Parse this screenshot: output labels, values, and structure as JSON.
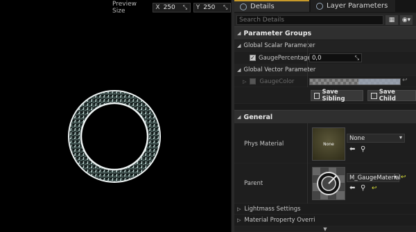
{
  "viewport": {
    "preview_size_label": "Preview Size",
    "x_axis": "X",
    "x_value": "250",
    "y_axis": "Y",
    "y_value": "250"
  },
  "tabs": [
    {
      "label": "Details",
      "icon": "details-icon",
      "active": true
    },
    {
      "label": "Layer Parameters",
      "icon": "layer-parameters-icon",
      "active": false
    }
  ],
  "search": {
    "placeholder": "Search Details"
  },
  "parameter_groups": {
    "header": "Parameter Groups",
    "scalar_group": "Global Scalar Parameter",
    "scalar_param": {
      "label": "GaugePercentage",
      "value": "0,0",
      "enabled": true
    },
    "vector_group": "Global Vector Parameter",
    "vector_param": {
      "label": "GaugeColor",
      "enabled": false
    },
    "save_sibling": "Save Sibling",
    "save_child": "Save Child"
  },
  "general": {
    "header": "General",
    "phys_material": {
      "label": "Phys Material",
      "thumb_text": "None",
      "value": "None"
    },
    "parent": {
      "label": "Parent",
      "value": "M_GaugeMaterial"
    },
    "lightmass": "Lightmass Settings",
    "material_property": "Material Property Overri"
  },
  "colors": {
    "accent_tab": "#c79a2a",
    "gauge_ring": "#e8f0f0",
    "parent_valid": "#3fbf3f"
  }
}
